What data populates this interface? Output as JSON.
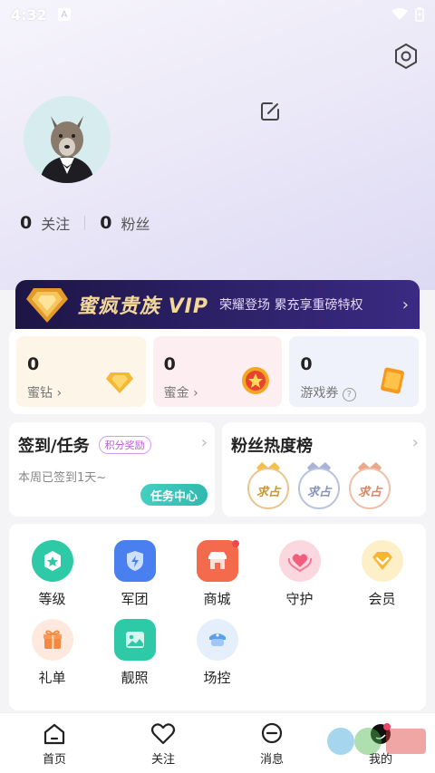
{
  "status": {
    "time": "4:32",
    "icon_a": "A"
  },
  "profile": {
    "avatar": "wolf-avatar",
    "following_count": "0",
    "following_label": "关注",
    "fans_count": "0",
    "fans_label": "粉丝"
  },
  "vip": {
    "title": "蜜疯贵族 VIP",
    "subtitle": "荣耀登场 累充享重磅特权"
  },
  "wallet": [
    {
      "value": "0",
      "label": "蜜钻 ›",
      "bg": "#fdf6e8"
    },
    {
      "value": "0",
      "label": "蜜金 ›",
      "bg": "#fdeff1"
    },
    {
      "value": "0",
      "label": "游戏券",
      "bg": "#f0f2fb"
    }
  ],
  "checkin": {
    "title": "签到/任务",
    "tag": "积分奖励",
    "subtitle": "本周已签到1天~",
    "button": "任务中心"
  },
  "fans_rank": {
    "title": "粉丝热度榜",
    "badge_text": "求占"
  },
  "grid": [
    {
      "label": "等级",
      "color": "#2ecaa8"
    },
    {
      "label": "军团",
      "color": "#4a7ff0"
    },
    {
      "label": "商城",
      "color": "#f46a4d"
    },
    {
      "label": "守护",
      "color": "#fbd8df"
    },
    {
      "label": "会员",
      "color": "#fdf0c8"
    },
    {
      "label": "礼单",
      "color": "#ffe9de"
    },
    {
      "label": "靓照",
      "color": "#2ecaa8"
    },
    {
      "label": "场控",
      "color": "#e4effb"
    }
  ],
  "tabs": [
    {
      "label": "首页"
    },
    {
      "label": "关注"
    },
    {
      "label": "消息"
    },
    {
      "label": "我的"
    }
  ]
}
